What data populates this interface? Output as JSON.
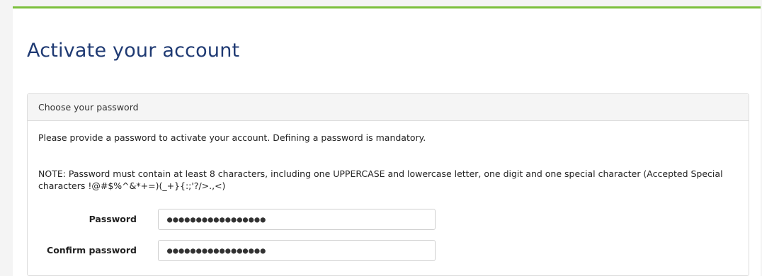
{
  "page": {
    "title": "Activate your account"
  },
  "panel": {
    "header": "Choose your password",
    "intro": "Please provide a password to activate your account. Defining a password is mandatory.",
    "note": "NOTE: Password must contain at least 8 characters, including one UPPERCASE and lowercase letter, one digit and one special character (Accepted Special characters !@#$%^&*+=)(_+}{:;'?/>.,<)"
  },
  "form": {
    "password": {
      "label": "Password",
      "value": "●●●●●●●●●●●●●●●●●"
    },
    "confirm_password": {
      "label": "Confirm password",
      "value": "●●●●●●●●●●●●●●●●●"
    }
  },
  "colors": {
    "accent_bar": "#7cbf3c",
    "title": "#1f3a73"
  }
}
